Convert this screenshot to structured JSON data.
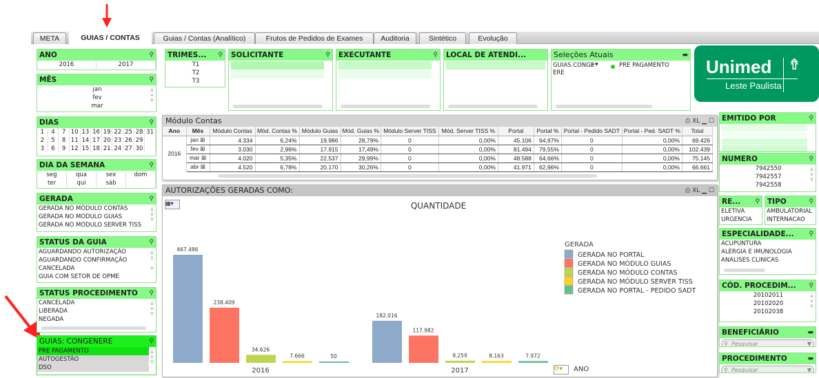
{
  "tabs": [
    {
      "label": "META"
    },
    {
      "label": "GUIAS / CONTAS",
      "active": true
    },
    {
      "label": "Guias / Contas (Analítico)"
    },
    {
      "label": "Frutos de Pedidos de Exames"
    },
    {
      "label": "Auditoria"
    },
    {
      "label": "Sintético"
    },
    {
      "label": "Evolução"
    }
  ],
  "ano": {
    "title": "ANO",
    "values": [
      "2016",
      "2017"
    ]
  },
  "mes": {
    "title": "MÊS",
    "values": [
      "jan",
      "fev",
      "mar"
    ]
  },
  "dias": {
    "title": "DIAS",
    "values": [
      "1",
      "4",
      "7",
      "10",
      "13",
      "16",
      "19",
      "22",
      "25",
      "28",
      "31",
      "2",
      "5",
      "8",
      "11",
      "14",
      "17",
      "20",
      "23",
      "26",
      "29",
      "",
      "3",
      "6",
      "9",
      "12",
      "15",
      "18",
      "21",
      "24",
      "27",
      "30",
      ""
    ]
  },
  "dia_semana": {
    "title": "DIA DA SEMANA",
    "values": [
      "seg",
      "qua",
      "sex",
      "dom",
      "ter",
      "qui",
      "sáb",
      ""
    ]
  },
  "gerada": {
    "title": "GERADA",
    "values": [
      "GERADA NO MÓDULO CONTAS",
      "GERADA NO MÓDULO GUIAS",
      "GERADA NO MÓDULO SERVER TISS"
    ]
  },
  "status_guia": {
    "title": "STATUS DA GUIA",
    "values": [
      "AGUARDANDO AUTORIZAÇÃO",
      "AGUARDANDO CONFIRMAÇÃO",
      "CANCELADA",
      "GUIA COM SETOR DE OPME"
    ]
  },
  "status_proc": {
    "title": "STATUS  PROCEDIMENTO",
    "values": [
      "CANCELADA",
      "LIBERADA",
      "NEGADA"
    ]
  },
  "congenere": {
    "title": "GUIAS:  CONGENERE",
    "values": [
      "PRE PAGAMENTO",
      "AUTOGESTÃO",
      "DSO"
    ],
    "selected": "PRE PAGAMENTO"
  },
  "trimestre": {
    "title": "TRIMES...",
    "values": [
      "T1",
      "T2",
      "T3"
    ]
  },
  "solicitante": {
    "title": "SOLICITANTE"
  },
  "executante": {
    "title": "EXECUTANTE"
  },
  "local": {
    "title": "LOCAL DE ATENDI..."
  },
  "selecoes": {
    "title": "Seleções Atuais",
    "field": "GUIAS.CONGENERE",
    "field_line1": "GUIAS.CONGE",
    "field_line2": "ERE",
    "value": "PRE PAGAMENTO"
  },
  "logo": {
    "brand": "Unimed",
    "region": "Leste Paulista",
    "color": "#00995d"
  },
  "emitido": {
    "title": "EMITIDO POR"
  },
  "numero": {
    "title": "NUMERO",
    "values": [
      "7942550",
      "7942557",
      "7942558"
    ]
  },
  "regime": {
    "title": "RE...",
    "values": [
      "ELETIVA",
      "URGENCIA"
    ]
  },
  "tipo": {
    "title": "TIPO",
    "values": [
      "AMBULATORIAL",
      "INTERNACAO"
    ]
  },
  "especialidade": {
    "title": "ESPECIALIDADE...",
    "values": [
      "ACUPUNTURA",
      "ALERGIA E IMUNOLOGIA",
      "ANALISES CLINICAS"
    ]
  },
  "cod_proc": {
    "title": "CÓD. PROCEDIM...",
    "values": [
      "20102011",
      "20102020",
      "20102038"
    ]
  },
  "beneficiario": {
    "title": "BENEFICIÁRIO",
    "placeholder": "Pesquisar"
  },
  "procedimento": {
    "title": "PROCEDIMENTO",
    "placeholder": "Pesquisar"
  },
  "modulo_contas": {
    "title": "Módulo Contas",
    "tools": "⎙ XL ▁ ☐",
    "headers": [
      "Ano",
      "Mês",
      "Módulo Contas",
      "Mód. Contas %",
      "Módulo Guias",
      "Mód. Guias %",
      "Módulo Server TISS",
      "Mód. Server TISS %",
      "Portal",
      "Portal %",
      "Portal - Pedido SADT",
      "Portal - Ped. SADT %",
      "Total"
    ],
    "year": "2016",
    "rows": [
      [
        "jan",
        "4.334",
        "6,24%",
        "19.986",
        "28,79%",
        "0",
        "0,00%",
        "45.106",
        "64,97%",
        "0",
        "0,00%",
        "69.426"
      ],
      [
        "fev",
        "3.030",
        "2,96%",
        "17.915",
        "17,49%",
        "0",
        "0,00%",
        "81.494",
        "79,55%",
        "0",
        "0,00%",
        "102.439"
      ],
      [
        "mar",
        "4.020",
        "5,35%",
        "22.537",
        "29,99%",
        "0",
        "0,00%",
        "48.588",
        "64,66%",
        "0",
        "0,00%",
        "75.145"
      ],
      [
        "abr",
        "4.520",
        "6,78%",
        "20.170",
        "30,26%",
        "0",
        "0,00%",
        "41.971",
        "62,96%",
        "0",
        "0,00%",
        "66.661"
      ]
    ]
  },
  "chart_panel": {
    "title": "AUTORIZAÇÕES GERADAS COMO:",
    "tools": "⎙ XL ▁ ☐",
    "dimension_label": "ANO"
  },
  "chart_data": {
    "type": "bar",
    "title": "QUANTIDADE",
    "legend_title": "GERADA",
    "legend_position": "right",
    "categories": [
      "2016",
      "2017"
    ],
    "series": [
      {
        "name": "GERADA NO PORTAL",
        "color": "#8eaacb",
        "values": [
          467486,
          182016
        ]
      },
      {
        "name": "GERADA NO MÓDULO GUIAS",
        "color": "#fd7462",
        "values": [
          238409,
          117982
        ]
      },
      {
        "name": "GERADA NO MÓDULO CONTAS",
        "color": "#bcd651",
        "values": [
          34626,
          9259
        ]
      },
      {
        "name": "GERADA NO MÓDULO SERVER TISS",
        "color": "#ffd320",
        "values": [
          7666,
          8163
        ]
      },
      {
        "name": "GERADA NO PORTAL - PEDIDO SADT",
        "color": "#5fc28f",
        "values": [
          50,
          7972
        ]
      }
    ],
    "labels": [
      [
        "467.486",
        "238.409",
        "34.626",
        "7.666",
        "50"
      ],
      [
        "182.016",
        "117.982",
        "9.259",
        "8.163",
        "7.972"
      ]
    ],
    "grid": false
  }
}
